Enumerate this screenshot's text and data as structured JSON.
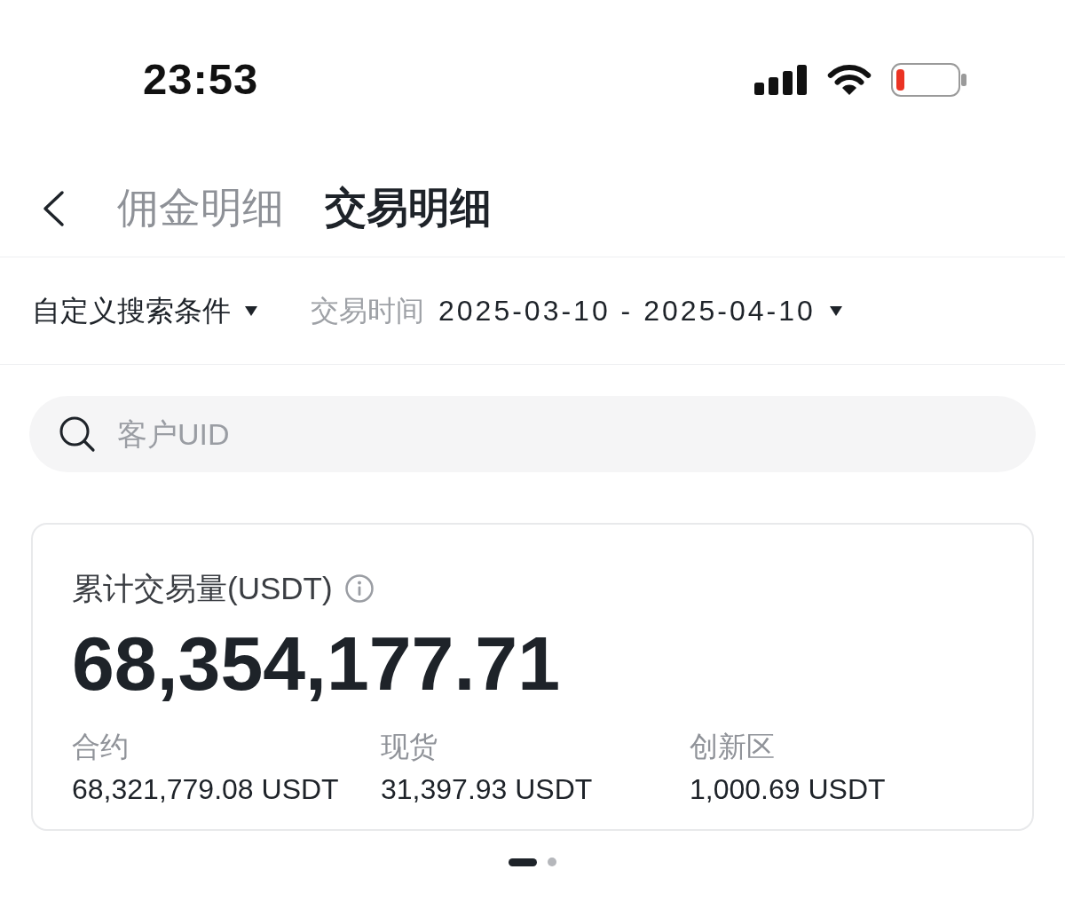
{
  "status_bar": {
    "time": "23:53"
  },
  "header": {
    "tabs": [
      {
        "label": "佣金明细",
        "selected": false
      },
      {
        "label": "交易明细",
        "selected": true
      }
    ]
  },
  "filters": [
    {
      "kind": "dropdown",
      "label": "自定义搜索条件"
    },
    {
      "kind": "date_range",
      "label": "交易时间",
      "value": "2025-03-10 - 2025-04-10"
    }
  ],
  "search": {
    "placeholder": "客户UID"
  },
  "summary_card": {
    "title": "累计交易量(USDT)",
    "total": "68,354,177.71",
    "breakdown": [
      {
        "label": "合约",
        "value": "68,321,779.08 USDT"
      },
      {
        "label": "现货",
        "value": "31,397.93 USDT"
      },
      {
        "label": "创新区",
        "value": "1,000.69 USDT"
      }
    ]
  },
  "pager": [
    {
      "selected": true
    },
    {
      "selected": false
    }
  ]
}
